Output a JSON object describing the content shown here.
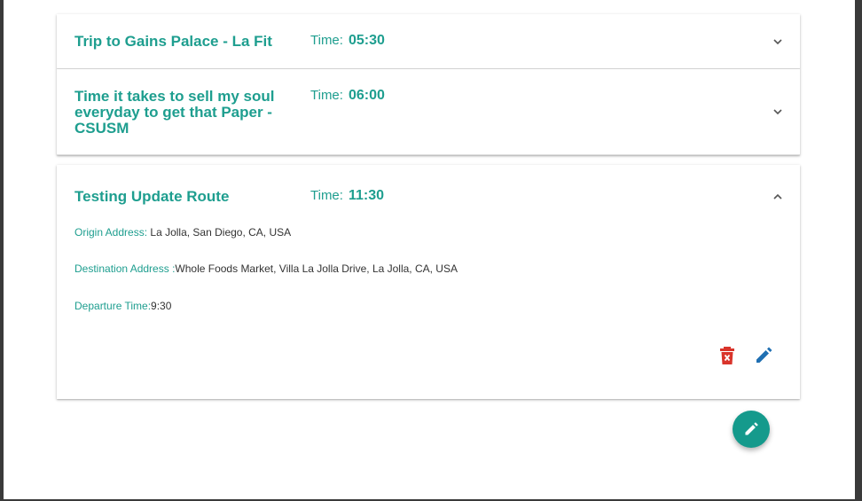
{
  "routes": [
    {
      "title": "Trip to Gains Palace - La Fit",
      "time_label": "Time:",
      "time_value": "05:30",
      "expanded": false
    },
    {
      "title": "Time it takes to sell my soul everyday to get that Paper - CSUSM",
      "time_label": "Time:",
      "time_value": "06:00",
      "expanded": false
    },
    {
      "title": "Testing Update Route",
      "time_label": "Time:",
      "time_value": "11:30",
      "expanded": true,
      "details": {
        "origin_label": "Origin Address:",
        "origin_value": "La Jolla, San Diego, CA, USA",
        "destination_label": "Destination Address :",
        "destination_value": "Whole Foods Market, Villa La Jolla Drive, La Jolla, CA, USA",
        "departure_label": "Departure Time:",
        "departure_value": "9:30"
      }
    }
  ],
  "icons": {
    "collapsed": "chevron-down-icon",
    "expanded": "chevron-up-icon",
    "delete": "delete-icon",
    "edit": "edit-icon",
    "fab": "edit-icon"
  },
  "colors": {
    "accent": "#1e9e8f",
    "fab": "#159a8c",
    "delete": "#d9342b",
    "edit": "#1f6fb2"
  }
}
